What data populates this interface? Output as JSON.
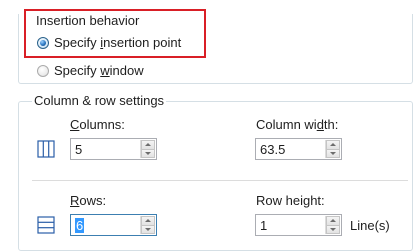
{
  "insertion_behavior": {
    "legend": "Insertion behavior",
    "options": [
      {
        "pre": "Specify ",
        "mnemonic": "i",
        "post": "nsertion point",
        "checked": true
      },
      {
        "pre": "Specify ",
        "mnemonic": "w",
        "post": "indow",
        "checked": false
      }
    ]
  },
  "column_row_settings": {
    "legend": "Column & row settings",
    "columns": {
      "label_mnemonic": "C",
      "label_rest": "olumns:",
      "value": "5"
    },
    "column_width": {
      "label_pre": "Column wi",
      "label_mnemonic": "d",
      "label_post": "th:",
      "value": "63.5"
    },
    "rows": {
      "label_mnemonic": "R",
      "label_rest": "ows:",
      "value": "6"
    },
    "row_height": {
      "label": "Row height:",
      "value": "1",
      "unit": "Line(s)"
    }
  },
  "colors": {
    "highlight": "#d91f26",
    "group_border": "#d5dfe5",
    "icon_blue": "#2a5ea8"
  },
  "icons": {
    "columns": "columns-grid-icon",
    "rows": "rows-grid-icon"
  }
}
